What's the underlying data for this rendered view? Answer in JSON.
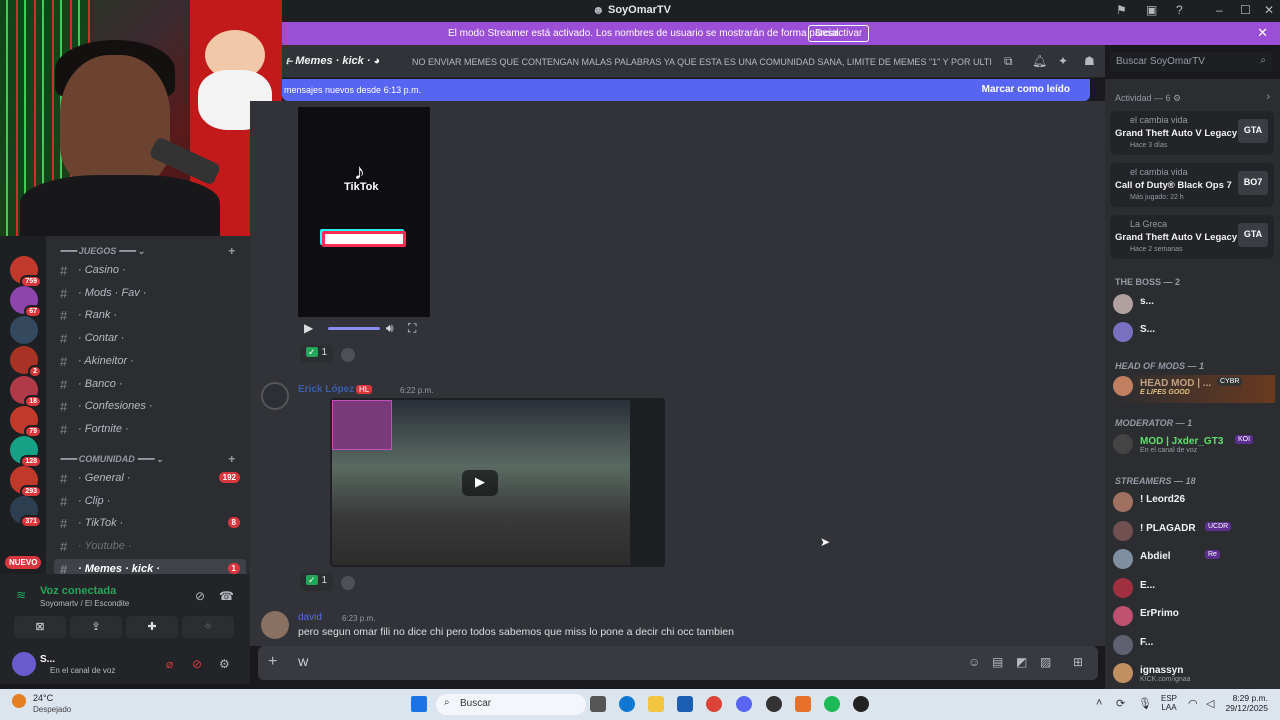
{
  "window": {
    "title": "SoyOmarTV"
  },
  "banner": {
    "text": "El modo Streamer está activado. Los nombres de usuario se mostrarán de forma parcial.",
    "button": "Desactivar"
  },
  "channel_header": {
    "name": "Memes · kick ·",
    "topic": "NO ENVIAR MEMES QUE CONTENGAN MALAS PALABRAS YA QUE ESTA ES UNA COMUNIDAD SANA, LIMITE DE MEMES \"1\" Y POR ULTIMO E...",
    "search_placeholder": "Buscar SoyOmarTV"
  },
  "new_messages": {
    "text": "mensajes nuevos desde 6:13 p.m.",
    "mark_read": "Marcar como leído"
  },
  "servers": [
    {
      "count": "759",
      "color": "#c0392b"
    },
    {
      "count": "67",
      "color": "#8e44ad"
    },
    {
      "count": "",
      "color": "#34495e"
    },
    {
      "count": "2",
      "color": "#a93226"
    },
    {
      "count": "18",
      "color": "#b03a48"
    },
    {
      "count": "79",
      "color": "#c0392b"
    },
    {
      "count": "128",
      "color": "#16a085"
    },
    {
      "count": "293",
      "color": "#c0392b"
    },
    {
      "count": "371",
      "color": "#2c3e50"
    }
  ],
  "nuevo_label": "NUEVO",
  "categories": {
    "juegos": "JUEGOS",
    "comunidad": "COMUNIDAD"
  },
  "channels_juegos": [
    {
      "label": "· Casino ·",
      "badge": ""
    },
    {
      "label": "· Mods · Fav ·",
      "badge": ""
    },
    {
      "label": "· Rank ·",
      "badge": ""
    },
    {
      "label": "· Contar ·",
      "badge": ""
    },
    {
      "label": "· Akineitor ·",
      "badge": ""
    },
    {
      "label": "· Banco ·",
      "badge": ""
    },
    {
      "label": "· Confesiones ·",
      "badge": ""
    },
    {
      "label": "· Fortnite ·",
      "badge": ""
    }
  ],
  "channels_comunidad": [
    {
      "label": "· General ·",
      "badge": "192"
    },
    {
      "label": "· Clip ·",
      "badge": ""
    },
    {
      "label": "· TikTok ·",
      "badge": "8"
    },
    {
      "label": "· Youtube ·",
      "badge": ""
    },
    {
      "label": "· Memes · kick ·",
      "badge": "1"
    }
  ],
  "voice": {
    "status": "Voz conectada",
    "server": "Soyomartv / El Escondite",
    "user": "S...",
    "user_status": "En el canal de voz"
  },
  "messages": {
    "tiktok_logo": "TikTok",
    "reaction_count_1": "1",
    "author_2": "Erick López",
    "author_2_tag": "HL",
    "time_2": "6:22 p.m.",
    "reaction_count_2": "1",
    "author_3": "david",
    "time_3": "6:23 p.m.",
    "text_3": "pero segun omar fili no dice chi pero todos sabemos que miss lo pone a decir chi occ tambien"
  },
  "composer": {
    "value": "W"
  },
  "members": {
    "activity_title": "Actividad — 6",
    "activities": [
      {
        "who": "el cambia vida",
        "game": "Grand Theft Auto V Legacy",
        "when": "Hace 3 días",
        "icon": "GTA"
      },
      {
        "who": "el cambia vida",
        "game": "Call of Duty® Black Ops 7",
        "when": "Más jugado: 22 h",
        "icon": "BO7"
      },
      {
        "who": "La Greca",
        "game": "Grand Theft Auto V Legacy",
        "when": "Hace 2 semanas",
        "icon": "GTA"
      }
    ],
    "role_boss": "THE BOSS — 2",
    "boss_members": [
      "s...",
      "S..."
    ],
    "role_headmods": "HEAD OF MODS — 1",
    "headmod_name": "HEAD MOD | ...",
    "headmod_tag": "CYBR",
    "headmod_sub": "E LIFES GOOD",
    "role_moderator": "MODERATOR — 1",
    "mod_name": "MOD | Jxder_GT3",
    "mod_tag": "KOI",
    "mod_sub": "En el canal de voz",
    "role_streamers": "STREAMERS — 18",
    "streamers": [
      {
        "name": "! Leord26",
        "tag": "",
        "sub": ""
      },
      {
        "name": "! PLAGADR",
        "tag": "UCDR",
        "sub": ""
      },
      {
        "name": "Abdiel",
        "tag": "Re",
        "sub": ""
      },
      {
        "name": "E...",
        "tag": "",
        "sub": ""
      },
      {
        "name": "ErPrimo",
        "tag": "",
        "sub": ""
      },
      {
        "name": "F...",
        "tag": "",
        "sub": ""
      },
      {
        "name": "ignassyn",
        "tag": "",
        "sub": "KICK.com/ignaa"
      }
    ]
  },
  "taskbar": {
    "temp": "24°C",
    "weather": "Despejado",
    "search": "Buscar",
    "lang1": "ESP",
    "lang2": "LAA",
    "time": "8:29 p.m.",
    "date": "29/12/2025"
  }
}
